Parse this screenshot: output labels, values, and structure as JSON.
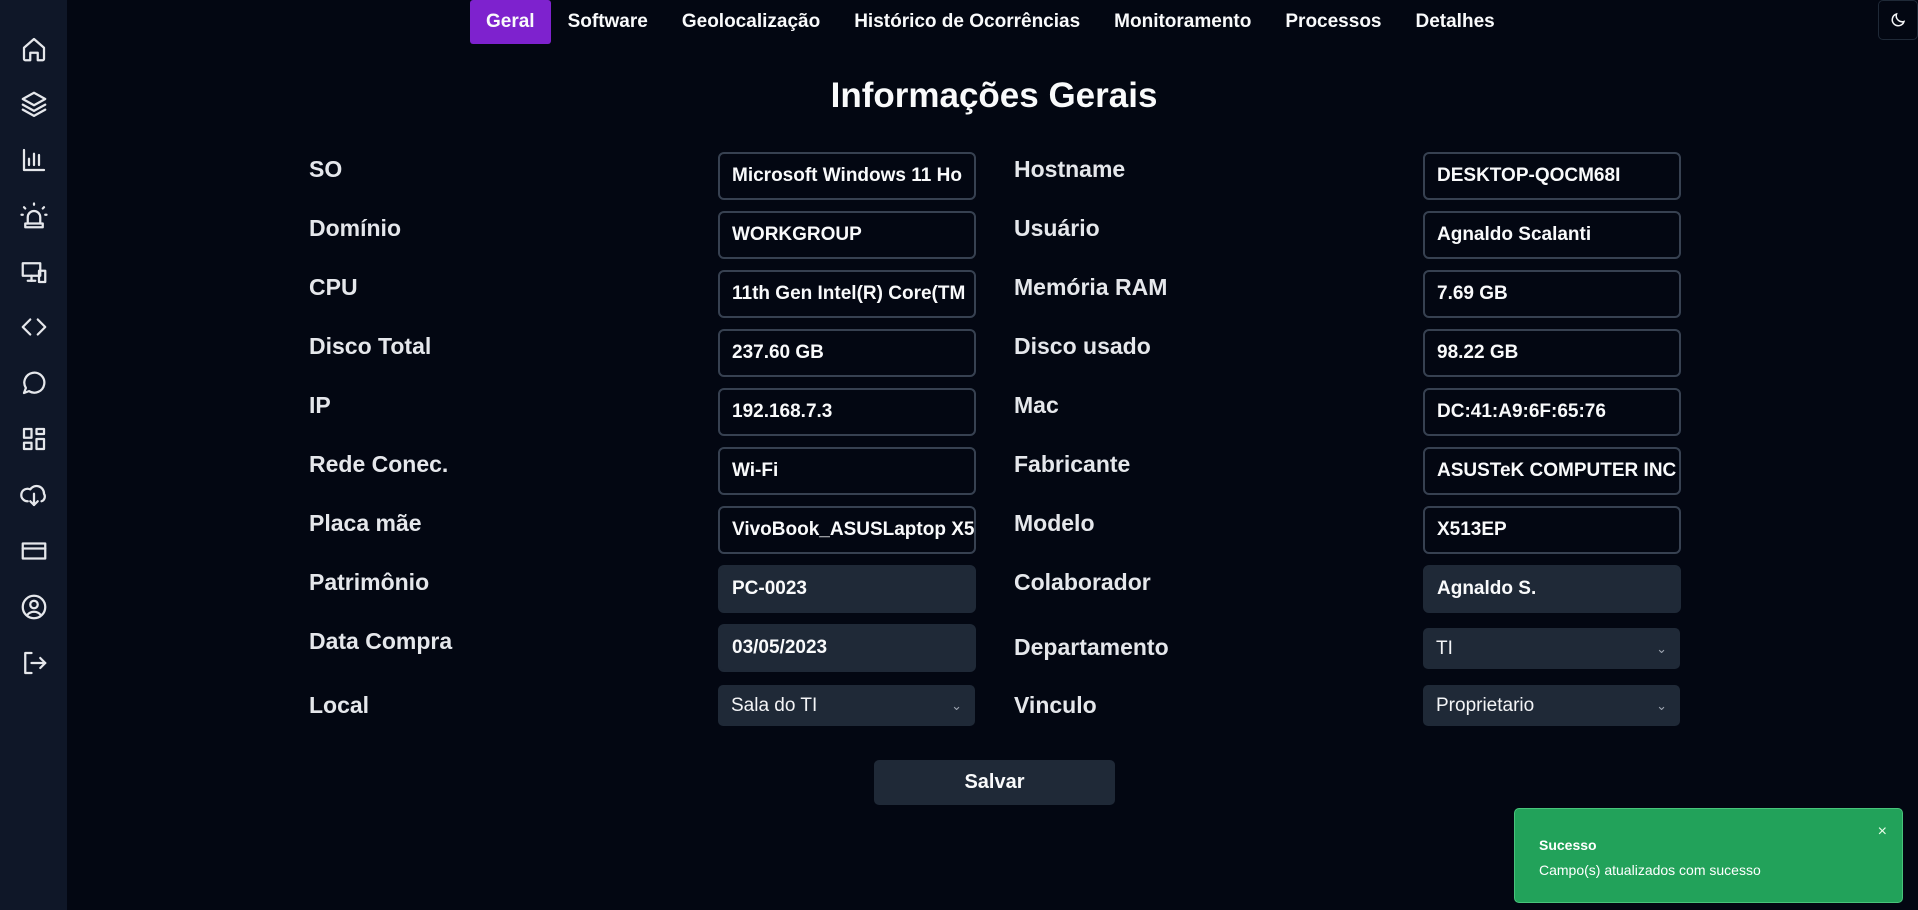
{
  "tabs": [
    {
      "label": "Geral",
      "active": true
    },
    {
      "label": "Software",
      "active": false
    },
    {
      "label": "Geolocalização",
      "active": false
    },
    {
      "label": "Histórico de Ocorrências",
      "active": false
    },
    {
      "label": "Monitoramento",
      "active": false
    },
    {
      "label": "Processos",
      "active": false
    },
    {
      "label": "Detalhes",
      "active": false
    }
  ],
  "title": "Informações Gerais",
  "sidebar": {
    "icons": [
      "home-icon",
      "layers-icon",
      "chart-icon",
      "siren-icon",
      "devices-icon",
      "code-icon",
      "chat-icon",
      "dashboard-icon",
      "download-cloud-icon",
      "credit-card-icon",
      "user-circle-icon",
      "logout-icon"
    ]
  },
  "fields": {
    "so": {
      "label": "SO",
      "value": "Microsoft Windows 11 Ho"
    },
    "hostname": {
      "label": "Hostname",
      "value": "DESKTOP-QOCM68I"
    },
    "dominio": {
      "label": "Domínio",
      "value": "WORKGROUP"
    },
    "usuario": {
      "label": "Usuário",
      "value": "Agnaldo Scalanti"
    },
    "cpu": {
      "label": "CPU",
      "value": "11th Gen Intel(R) Core(TM"
    },
    "ram": {
      "label": "Memória RAM",
      "value": "7.69 GB"
    },
    "disco_total": {
      "label": "Disco Total",
      "value": "237.60 GB"
    },
    "disco_usado": {
      "label": "Disco usado",
      "value": "98.22 GB"
    },
    "ip": {
      "label": "IP",
      "value": "192.168.7.3"
    },
    "mac": {
      "label": "Mac",
      "value": "DC:41:A9:6F:65:76"
    },
    "rede": {
      "label": "Rede Conec.",
      "value": "Wi-Fi"
    },
    "fabricante": {
      "label": "Fabricante",
      "value": "ASUSTeK COMPUTER INC"
    },
    "placa": {
      "label": "Placa mãe",
      "value": "VivoBook_ASUSLaptop X5"
    },
    "modelo": {
      "label": "Modelo",
      "value": "X513EP"
    },
    "patrimonio": {
      "label": "Patrimônio",
      "value": "PC-0023"
    },
    "colaborador": {
      "label": "Colaborador",
      "value": "Agnaldo S."
    },
    "data_compra": {
      "label": "Data Compra",
      "value": "03/05/2023"
    },
    "departamento": {
      "label": "Departamento",
      "value": "TI"
    },
    "local": {
      "label": "Local",
      "value": "Sala do TI"
    },
    "vinculo": {
      "label": "Vinculo",
      "value": "Proprietario"
    }
  },
  "save_label": "Salvar",
  "toast": {
    "title": "Sucesso",
    "message": "Campo(s) atualizados com sucesso",
    "close": "×",
    "color": "#22a25a"
  },
  "colors": {
    "accent": "#7e22ce",
    "background": "#030712",
    "sidebar": "#0f1728"
  }
}
